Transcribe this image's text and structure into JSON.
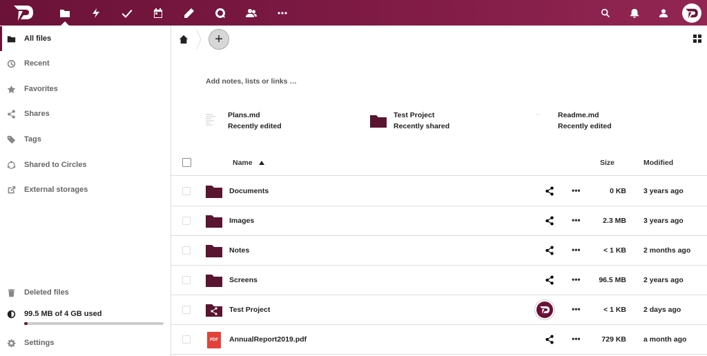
{
  "header": {
    "apps": [
      "files-icon",
      "activity-icon",
      "tasks-icon",
      "calendar-icon",
      "notes-icon",
      "talk-icon",
      "contacts-icon",
      "more-apps-icon"
    ],
    "right": [
      "search-icon",
      "notifications-icon",
      "contacts-menu-icon",
      "user-avatar"
    ]
  },
  "sidebar": {
    "items": [
      {
        "label": "All files",
        "icon": "folder-icon"
      },
      {
        "label": "Recent",
        "icon": "clock-icon"
      },
      {
        "label": "Favorites",
        "icon": "star-icon"
      },
      {
        "label": "Shares",
        "icon": "share-icon"
      },
      {
        "label": "Tags",
        "icon": "tag-icon"
      },
      {
        "label": "Shared to Circles",
        "icon": "circles-icon"
      },
      {
        "label": "External storages",
        "icon": "external-link-icon"
      }
    ],
    "deleted": "Deleted files",
    "quota": "99.5 MB of 4 GB used",
    "quota_fraction": 0.025,
    "settings": "Settings"
  },
  "main": {
    "notes_placeholder": "Add notes, lists or links …",
    "recent": [
      {
        "name": "Plans.md",
        "sub": "Recently edited"
      },
      {
        "name": "Test Project",
        "sub": "Recently shared"
      },
      {
        "name": "Readme.md",
        "sub": "Recently edited"
      }
    ],
    "columns": {
      "name": "Name",
      "size": "Size",
      "modified": "Modified"
    },
    "files": [
      {
        "name": "Documents",
        "type": "folder",
        "size": "0 KB",
        "modified": "3 years ago"
      },
      {
        "name": "Images",
        "type": "folder",
        "size": "2.3 MB",
        "modified": "3 years ago"
      },
      {
        "name": "Notes",
        "type": "folder",
        "size": "< 1 KB",
        "modified": "2 months ago"
      },
      {
        "name": "Screens",
        "type": "folder",
        "size": "96.5 MB",
        "modified": "2 years ago"
      },
      {
        "name": "Test Project",
        "type": "shared-folder",
        "size": "< 1 KB",
        "modified": "2 days ago"
      },
      {
        "name": "AnnualReport2019.pdf",
        "type": "pdf",
        "size": "729 KB",
        "modified": "a month ago"
      }
    ],
    "pdf_badge": "PDF",
    "more": "•••"
  },
  "colors": {
    "brand": "#6b1238",
    "folder": "#5a1530",
    "pdf": "#e2423a"
  }
}
